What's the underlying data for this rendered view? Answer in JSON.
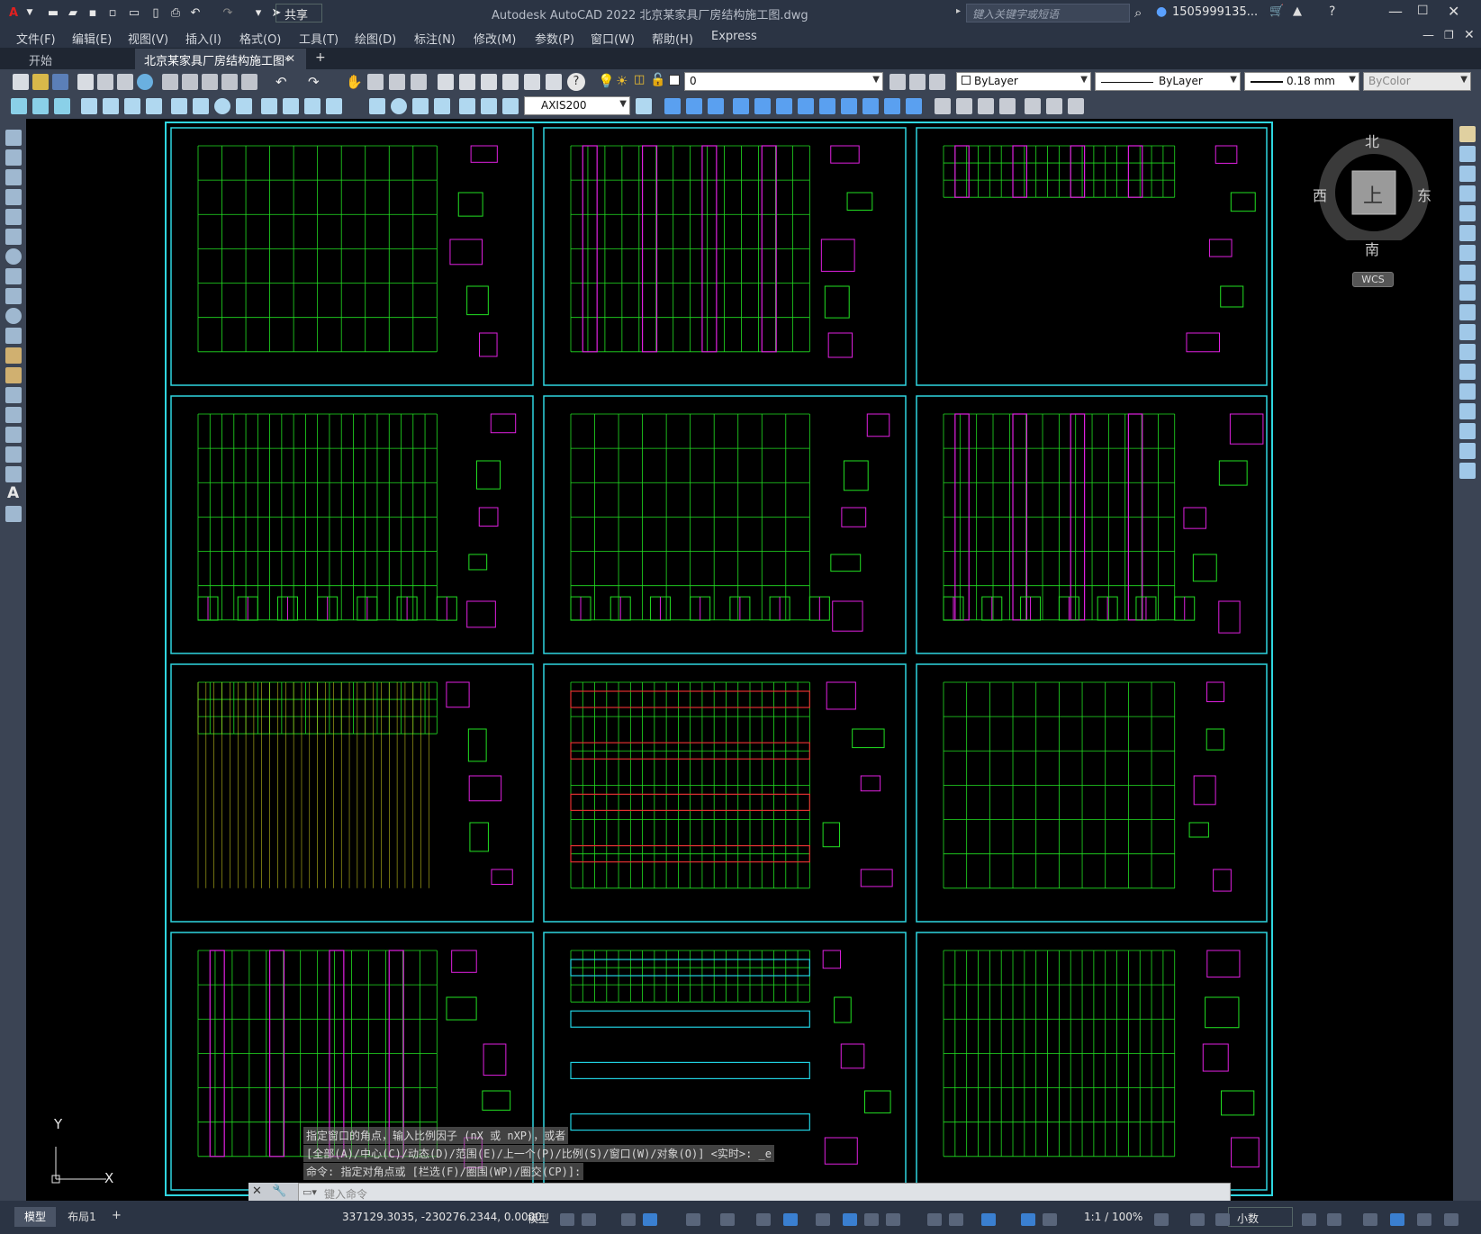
{
  "titlebar": {
    "app_title": "Autodesk AutoCAD 2022    北京某家具厂房结构施工图.dwg",
    "share_label": "共享",
    "search_placeholder": "键入关键字或短语",
    "user": "1505999135...",
    "app_icon": "autocad-logo-icon",
    "window_controls": [
      "minimize-icon",
      "restore-icon",
      "close-icon"
    ]
  },
  "menubar": {
    "items": [
      "文件(F)",
      "编辑(E)",
      "视图(V)",
      "插入(I)",
      "格式(O)",
      "工具(T)",
      "绘图(D)",
      "标注(N)",
      "修改(M)",
      "参数(P)",
      "窗口(W)",
      "帮助(H)",
      "Express"
    ]
  },
  "doc_tabs": {
    "start": "开始",
    "active": "北京某家具厂房结构施工图*",
    "add": "+"
  },
  "toolbar": {
    "layer_value": "0",
    "color_value": "ByLayer",
    "linetype_value": "ByLayer",
    "lineweight_value": "0.18 mm",
    "plotstyle_value": "ByColor",
    "dimstyle_value": "AXIS200"
  },
  "viewcube": {
    "north": "北",
    "south": "南",
    "east": "东",
    "west": "西",
    "top": "上",
    "wcs": "WCS"
  },
  "ucs": {
    "y": "Y",
    "x": "X"
  },
  "command_history": [
    "指定窗口的角点，输入比例因子 (nX 或 nXP)，或者",
    "[全部(A)/中心(C)/动态(D)/范围(E)/上一个(P)/比例(S)/窗口(W)/对象(O)] <实时>: _e",
    "命令: 指定对角点或 [栏选(F)/圈围(WP)/圈交(CP)]:"
  ],
  "command_input_placeholder": "键入命令",
  "layout_tabs": {
    "model": "模型",
    "layout1": "布局1",
    "add": "+"
  },
  "statusbar": {
    "coords": "337129.3035, -230276.2344, 0.0000",
    "space": "模型",
    "scale": "1:1 / 100%",
    "units": "小数"
  },
  "colors": {
    "frame": "#2fd6e0",
    "drawing_green": "#22e022",
    "drawing_magenta": "#e020e0",
    "drawing_red": "#e03030",
    "drawing_yellow": "#e0e020",
    "drawing_cyan": "#20d0e0",
    "ui_dark": "#2b3444",
    "ui_mid": "#3b4454"
  }
}
